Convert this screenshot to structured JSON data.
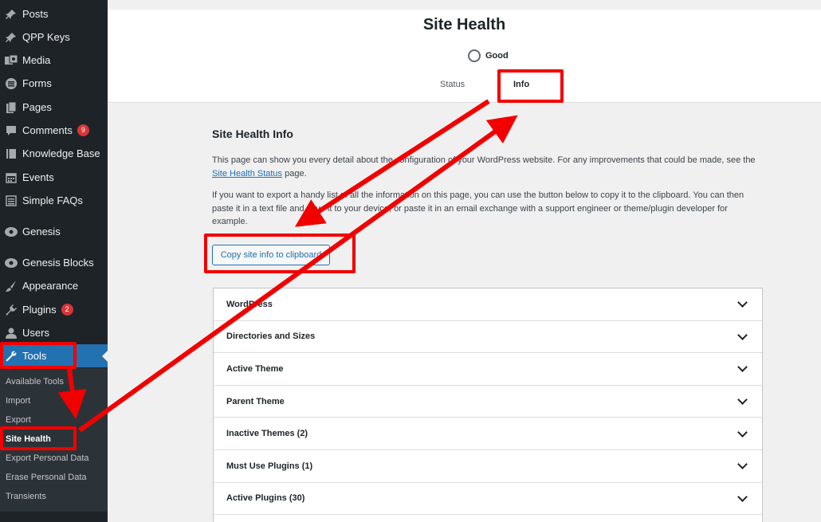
{
  "sidebar": {
    "items": [
      {
        "label": "Posts",
        "icon": "pin-icon"
      },
      {
        "label": "QPP Keys",
        "icon": "pin-icon"
      },
      {
        "label": "Media",
        "icon": "media-icon"
      },
      {
        "label": "Forms",
        "icon": "forms-icon"
      },
      {
        "label": "Pages",
        "icon": "pages-icon"
      },
      {
        "label": "Comments",
        "icon": "comment-icon",
        "badge": "9"
      },
      {
        "label": "Knowledge Base",
        "icon": "book-icon"
      },
      {
        "label": "Events",
        "icon": "calendar-icon"
      },
      {
        "label": "Simple FAQs",
        "icon": "list-icon"
      },
      {
        "label": "Genesis",
        "icon": "genesis-icon"
      },
      {
        "label": "Genesis Blocks",
        "icon": "genesis-blocks-icon"
      },
      {
        "label": "Appearance",
        "icon": "brush-icon"
      },
      {
        "label": "Plugins",
        "icon": "plugin-icon",
        "badge": "2"
      },
      {
        "label": "Users",
        "icon": "user-icon"
      },
      {
        "label": "Tools",
        "icon": "wrench-icon"
      }
    ],
    "submenu": [
      "Available Tools",
      "Import",
      "Export",
      "Site Health",
      "Export Personal Data",
      "Erase Personal Data",
      "Transients"
    ]
  },
  "header": {
    "title": "Site Health",
    "status": "Good",
    "tabs": [
      "Status",
      "Info"
    ]
  },
  "content": {
    "title": "Site Health Info",
    "para1_a": "This page can show you every detail about the configuration of your WordPress website. For any improvements that could be made, see the ",
    "para1_link": "Site Health Status",
    "para1_b": " page.",
    "para2": "If you want to export a handy list of all the information on this page, you can use the button below to copy it to the clipboard. You can then paste it in a text file and save it to your device, or paste it in an email exchange with a support engineer or theme/plugin developer for example.",
    "copy_button": "Copy site info to clipboard"
  },
  "accordion": [
    "WordPress",
    "Directories and Sizes",
    "Active Theme",
    "Parent Theme",
    "Inactive Themes (2)",
    "Must Use Plugins (1)",
    "Active Plugins (30)"
  ],
  "colors": {
    "annotation": "#f20000",
    "accent": "#2271b1",
    "sidebar": "#1d2327"
  }
}
